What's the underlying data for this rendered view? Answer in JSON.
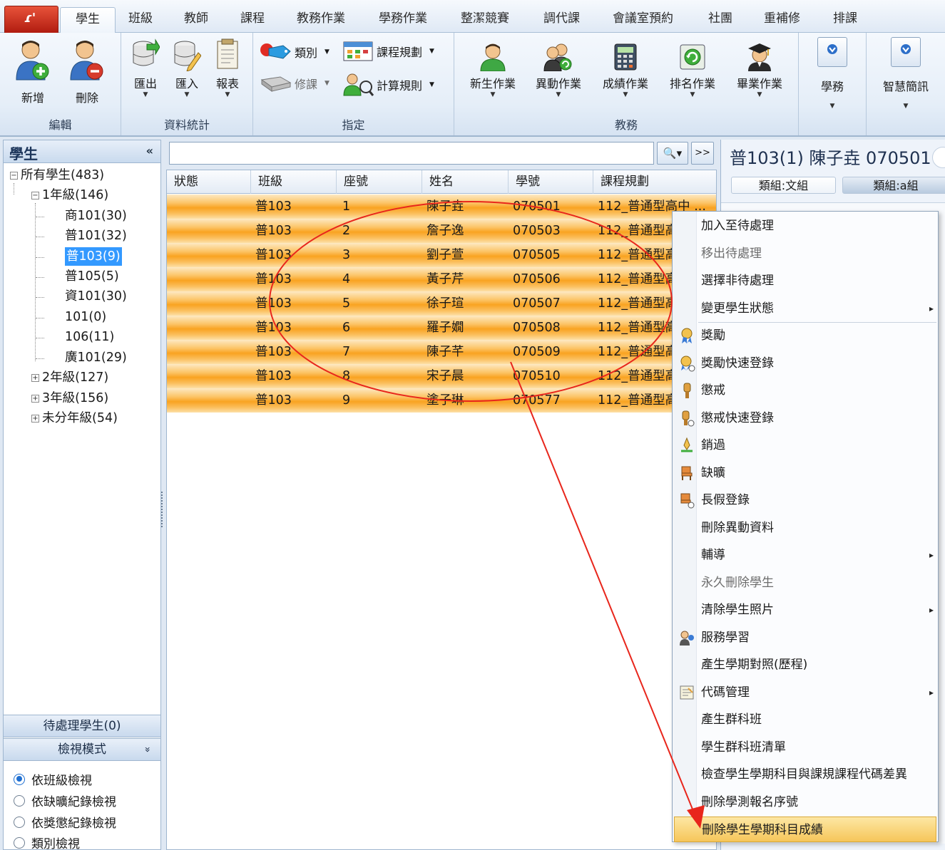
{
  "tabs": [
    "學生",
    "班級",
    "教師",
    "課程",
    "教務作業",
    "學務作業",
    "整潔競賽",
    "調代課",
    "會議室預約",
    "社團",
    "重補修",
    "排課"
  ],
  "ribbon": {
    "groups": {
      "edit": "編輯",
      "stats": "資料統計",
      "assign": "指定",
      "academic": "教務",
      "student_affairs": "學務",
      "smart": "智慧簡訊"
    },
    "buttons": {
      "add": "新增",
      "delete": "刪除",
      "export": "匯出",
      "import": "匯入",
      "report": "報表",
      "category": "類別",
      "course_plan": "課程規劃",
      "elective": "修課",
      "calc_rule": "計算規則",
      "new_student": "新生作業",
      "transfer": "異動作業",
      "grades": "成績作業",
      "ranking": "排名作業",
      "graduation": "畢業作業",
      "student_affairs": "學務",
      "smart_sms": "智慧簡訊"
    }
  },
  "left": {
    "title": "學生",
    "collapse": "«",
    "tree": {
      "root": "所有學生(483)",
      "grade1": "1年級(146)",
      "c1": "商101(30)",
      "c2": "普101(32)",
      "c3": "普103(9)",
      "c4": "普105(5)",
      "c5": "資101(30)",
      "c6": "101(0)",
      "c7": "106(11)",
      "c8": "廣101(29)",
      "grade2": "2年級(127)",
      "grade3": "3年級(156)",
      "ungraded": "未分年級(54)"
    },
    "pending": "待處理學生(0)",
    "view_mode": "檢視模式",
    "view_mode_chev": "»",
    "views": [
      "依班級檢視",
      "依缺曠紀錄檢視",
      "依獎懲紀錄檢視",
      "類別檢視"
    ]
  },
  "search": {
    "value": "",
    "search_btn": "🔍▾",
    "more_btn": ">>"
  },
  "grid": {
    "columns": [
      "狀態",
      "班級",
      "座號",
      "姓名",
      "學號",
      "課程規劃"
    ],
    "rows": [
      [
        "",
        "普103",
        "1",
        "陳子垚",
        "070501",
        "112_普通型高中 ..."
      ],
      [
        "",
        "普103",
        "2",
        "詹子逸",
        "070503",
        "112_普通型高中"
      ],
      [
        "",
        "普103",
        "3",
        "劉子萱",
        "070505",
        "112_普通型高中"
      ],
      [
        "",
        "普103",
        "4",
        "黃子芹",
        "070506",
        "112_普通型高中"
      ],
      [
        "",
        "普103",
        "5",
        "徐子瑄",
        "070507",
        "112_普通型高中"
      ],
      [
        "",
        "普103",
        "6",
        "羅子嫺",
        "070508",
        "112_普通型高中"
      ],
      [
        "",
        "普103",
        "7",
        "陳子芊",
        "070509",
        "112_普通型高中"
      ],
      [
        "",
        "普103",
        "8",
        "宋子晨",
        "070510",
        "112_普通型高中"
      ],
      [
        "",
        "普103",
        "9",
        "塗子琳",
        "070577",
        "112_普通型高中"
      ]
    ]
  },
  "detail": {
    "title": "普103(1) 陳子垚 070501",
    "chip1": "類組:文組",
    "chip2": "類組:a組"
  },
  "context_menu": {
    "items": [
      {
        "label": "加入至待處理",
        "disabled": false
      },
      {
        "label": "移出待處理",
        "disabled": true
      },
      {
        "label": "選擇非待處理",
        "disabled": false
      },
      {
        "label": "變更學生狀態",
        "disabled": false
      },
      {
        "label": "獎勵",
        "disabled": false
      },
      {
        "label": "獎勵快速登錄",
        "disabled": false
      },
      {
        "label": "懲戒",
        "disabled": false
      },
      {
        "label": "懲戒快速登錄",
        "disabled": false
      },
      {
        "label": "銷過",
        "disabled": false
      },
      {
        "label": "缺曠",
        "disabled": false
      },
      {
        "label": "長假登錄",
        "disabled": false
      },
      {
        "label": "刪除異動資料",
        "disabled": false
      },
      {
        "label": "輔導",
        "disabled": false
      },
      {
        "label": "永久刪除學生",
        "disabled": true
      },
      {
        "label": "清除學生照片",
        "disabled": false
      },
      {
        "label": "服務學習",
        "disabled": false
      },
      {
        "label": "產生學期對照(歷程)",
        "disabled": false
      },
      {
        "label": "代碼管理",
        "disabled": false
      },
      {
        "label": "產生群科班",
        "disabled": false
      },
      {
        "label": "學生群科班清單",
        "disabled": false
      },
      {
        "label": "檢查學生學期科目與課規課程代碼差異",
        "disabled": false
      },
      {
        "label": "刪除學測報名序號",
        "disabled": false
      },
      {
        "label": "刪除學生學期科目成績",
        "disabled": false
      }
    ]
  },
  "annotation_color": "#e8261c"
}
